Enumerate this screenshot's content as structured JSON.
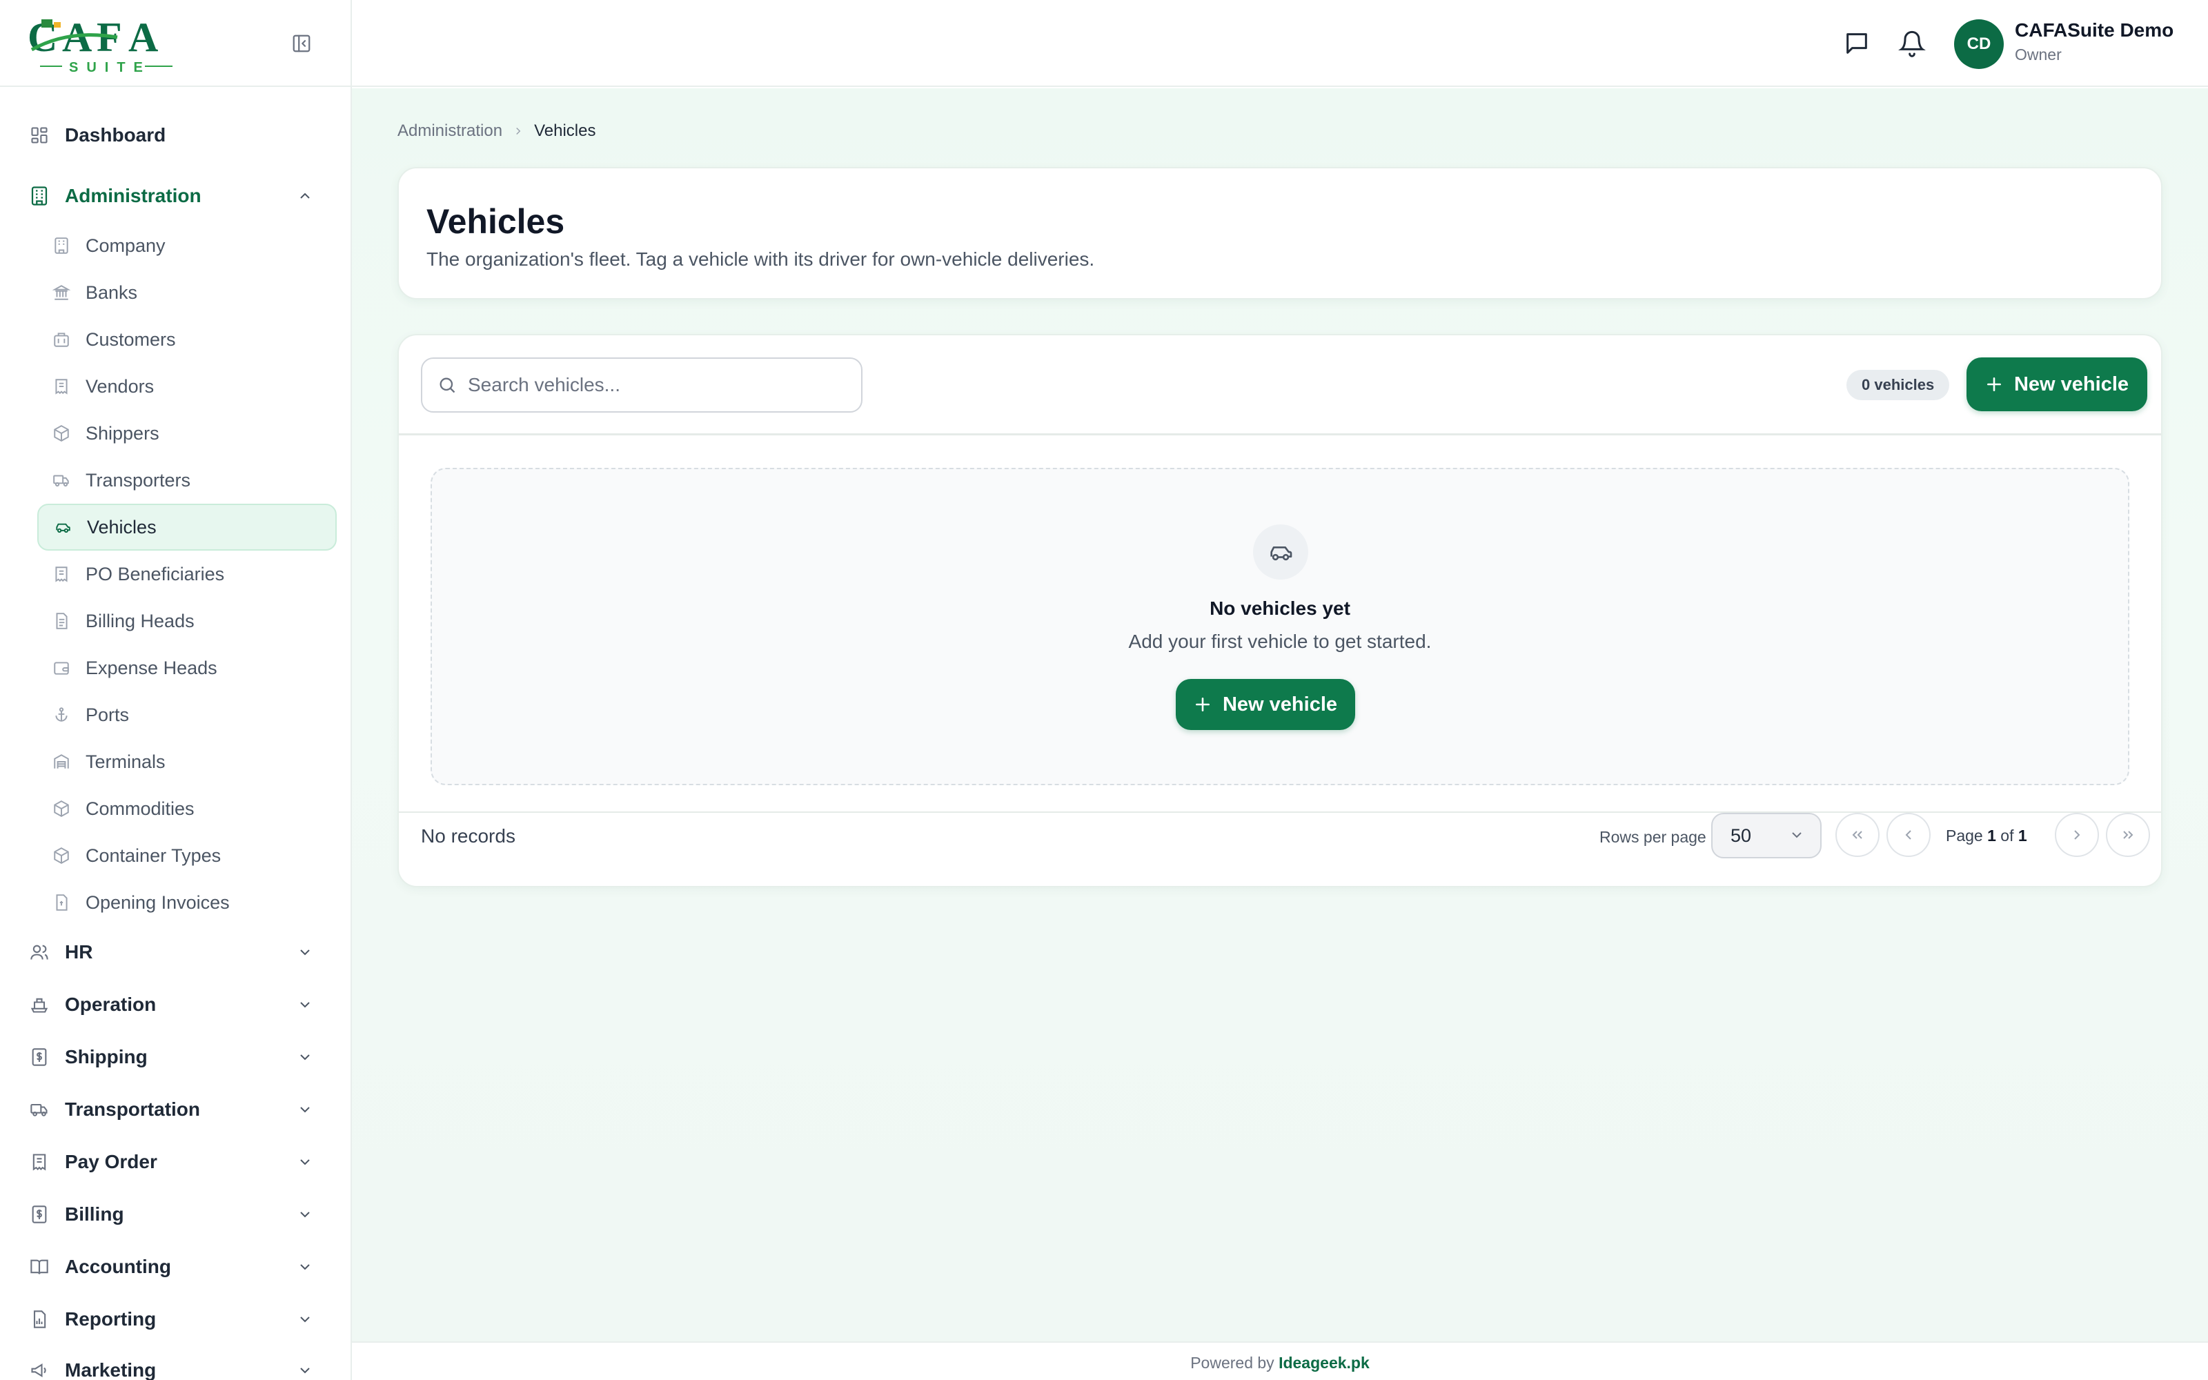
{
  "brand": {
    "logo_text": "CAFA",
    "logo_sub": "SUITE"
  },
  "sidebar": {
    "dashboard": {
      "label": "Dashboard",
      "icon": "grid-icon"
    },
    "administration": {
      "label": "Administration",
      "icon": "building-icon",
      "expanded": true,
      "items": [
        {
          "label": "Company",
          "icon": "building-icon"
        },
        {
          "label": "Banks",
          "icon": "bank-icon"
        },
        {
          "label": "Customers",
          "icon": "briefcase-icon"
        },
        {
          "label": "Vendors",
          "icon": "receipt-icon"
        },
        {
          "label": "Shippers",
          "icon": "package-icon"
        },
        {
          "label": "Transporters",
          "icon": "truck-icon"
        },
        {
          "label": "Vehicles",
          "icon": "car-icon",
          "active": true
        },
        {
          "label": "PO Beneficiaries",
          "icon": "receipt-icon"
        },
        {
          "label": "Billing Heads",
          "icon": "document-icon"
        },
        {
          "label": "Expense Heads",
          "icon": "wallet-icon"
        },
        {
          "label": "Ports",
          "icon": "anchor-icon"
        },
        {
          "label": "Terminals",
          "icon": "warehouse-icon"
        },
        {
          "label": "Commodities",
          "icon": "box-icon"
        },
        {
          "label": "Container Types",
          "icon": "box-icon"
        },
        {
          "label": "Opening Invoices",
          "icon": "invoice-icon"
        }
      ]
    },
    "groups": [
      {
        "label": "HR",
        "icon": "users-icon"
      },
      {
        "label": "Operation",
        "icon": "ship-icon"
      },
      {
        "label": "Shipping",
        "icon": "dollar-document-icon"
      },
      {
        "label": "Transportation",
        "icon": "truck-icon"
      },
      {
        "label": "Pay Order",
        "icon": "receipt-icon"
      },
      {
        "label": "Billing",
        "icon": "dollar-document-icon"
      },
      {
        "label": "Accounting",
        "icon": "book-icon"
      },
      {
        "label": "Reporting",
        "icon": "chart-document-icon"
      },
      {
        "label": "Marketing",
        "icon": "megaphone-icon"
      }
    ]
  },
  "header": {
    "user_initials": "CD",
    "user_name": "CAFASuite Demo",
    "user_role": "Owner"
  },
  "breadcrumb": {
    "parent": "Administration",
    "current": "Vehicles"
  },
  "page": {
    "title": "Vehicles",
    "description": "The organization's fleet. Tag a vehicle with its driver for own-vehicle deliveries."
  },
  "toolbar": {
    "search_placeholder": "Search vehicles...",
    "count_badge": "0 vehicles",
    "new_button": "New vehicle"
  },
  "empty_state": {
    "title": "No vehicles yet",
    "subtitle": "Add your first vehicle to get started.",
    "button": "New vehicle"
  },
  "pagination": {
    "records_text": "No records",
    "rows_label": "Rows per page",
    "rows_value": "50",
    "page_prefix": "Page",
    "page_current": "1",
    "page_of": "of",
    "page_total": "1"
  },
  "footer": {
    "prefix": "Powered by",
    "link": "Ideageek.pk"
  },
  "colors": {
    "accent": "#0e7a4c",
    "active_bg": "#e7f7ef",
    "main_bg": "#eef9f3"
  }
}
